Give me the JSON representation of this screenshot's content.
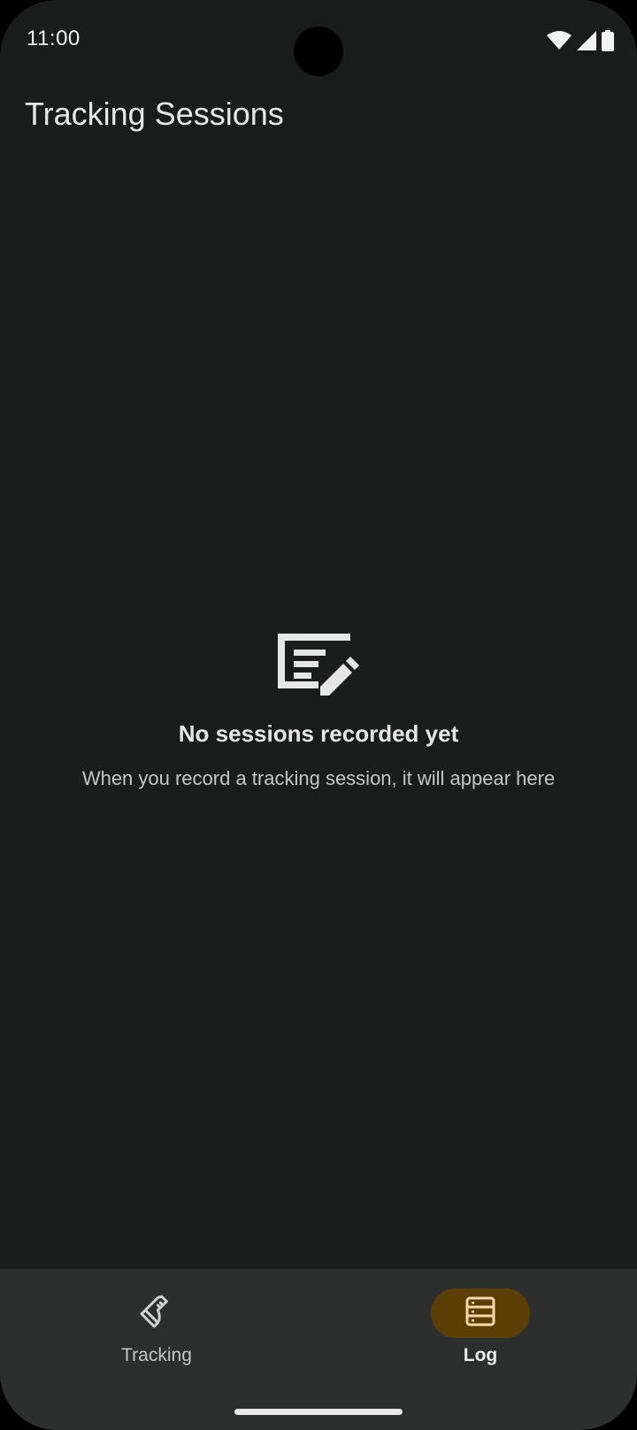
{
  "status_bar": {
    "time": "11:00",
    "icons": [
      "wifi-icon",
      "cellular-signal-icon",
      "battery-icon"
    ]
  },
  "app_bar": {
    "title": "Tracking Sessions"
  },
  "empty_state": {
    "icon": "edit-note-icon",
    "title": "No sessions recorded yet",
    "subtitle": "When you record a tracking session, it will appear here"
  },
  "bottom_nav": {
    "items": [
      {
        "label": "Tracking",
        "icon": "sneaker-icon",
        "selected": false
      },
      {
        "label": "Log",
        "icon": "list-log-icon",
        "selected": true
      }
    ]
  },
  "colors": {
    "background": "#1b1c1c",
    "nav_background": "#2d2f2f",
    "selected_indicator": "#5c3f07",
    "selected_icon": "#f5d9a8",
    "text_primary": "#e8e8e8",
    "text_secondary": "#c4c7c5"
  }
}
